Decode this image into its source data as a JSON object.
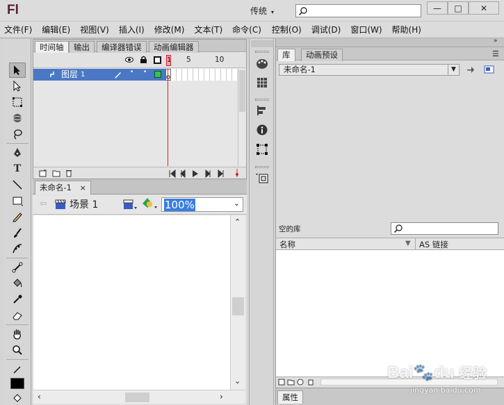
{
  "app": {
    "logo": "Fl",
    "workspace": "传统"
  },
  "window_controls": {
    "minimize": "—",
    "maximize": "□",
    "close": "✕"
  },
  "menu": [
    "文件(F)",
    "编辑(E)",
    "视图(V)",
    "插入(I)",
    "修改(M)",
    "文本(T)",
    "命令(C)",
    "控制(O)",
    "调试(D)",
    "窗口(W)",
    "帮助(H)"
  ],
  "timeline": {
    "tabs": [
      "时间轴",
      "输出",
      "编译器错误",
      "动画编辑器"
    ],
    "frame_numbers": [
      "1",
      "5",
      "10"
    ],
    "layer_name": "图层",
    "layer_number": "1"
  },
  "document": {
    "tab": "未命名-1",
    "tab_close": "×",
    "scene": "场景 1",
    "zoom": "100%"
  },
  "library": {
    "tabs": [
      "库",
      "动画预设"
    ],
    "doc_select": "未命名-1",
    "empty_label": "空的库",
    "col_name": "名称",
    "col_linkage": "AS 链接"
  },
  "properties": {
    "tab": "属性"
  },
  "watermark": {
    "logo_text": "Bai",
    "logo_text2": "du",
    "jingyan": "经验",
    "url": "jingyan.baidu.com"
  },
  "colors": {
    "playhead": "#d42030",
    "layer_highlight": "#4a78c4",
    "zoom_highlight": "#3a7ee0"
  }
}
